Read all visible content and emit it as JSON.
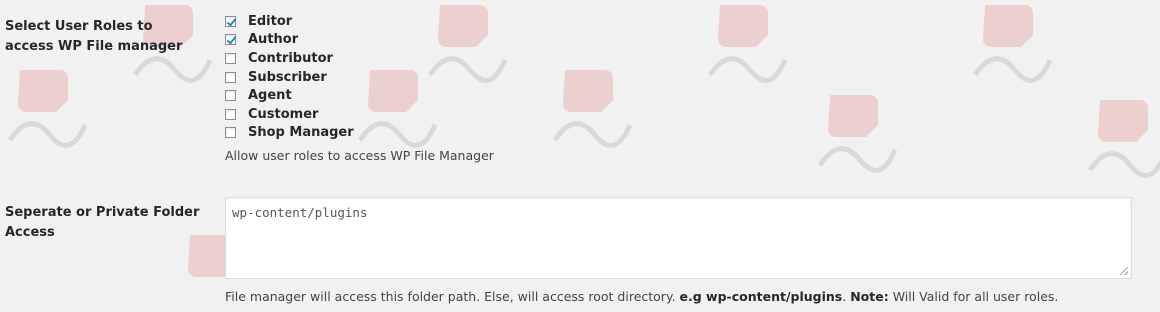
{
  "roles_setting": {
    "label": "Select User Roles to access WP File manager",
    "roles": [
      {
        "label": "Editor",
        "checked": true
      },
      {
        "label": "Author",
        "checked": true
      },
      {
        "label": "Contributor",
        "checked": false
      },
      {
        "label": "Subscriber",
        "checked": false
      },
      {
        "label": "Agent",
        "checked": false
      },
      {
        "label": "Customer",
        "checked": false
      },
      {
        "label": "Shop Manager",
        "checked": false
      }
    ],
    "description": "Allow user roles to access WP File Manager"
  },
  "folder_setting": {
    "label": "Seperate or Private Folder Access",
    "value": "wp-content/plugins",
    "description_text": "File manager will access this folder path. Else, will access root directory.",
    "example_label": "e.g wp-content/plugins",
    "note_label": "Note:",
    "note_text": "Will Valid for all user roles."
  },
  "colors": {
    "background": "#f1f1f1",
    "checkbox_check": "#1e8cbe",
    "watermark_red": "#e8a0a0",
    "watermark_gray": "#c8c8c8"
  },
  "watermark_icon": "raised-fist-logo"
}
